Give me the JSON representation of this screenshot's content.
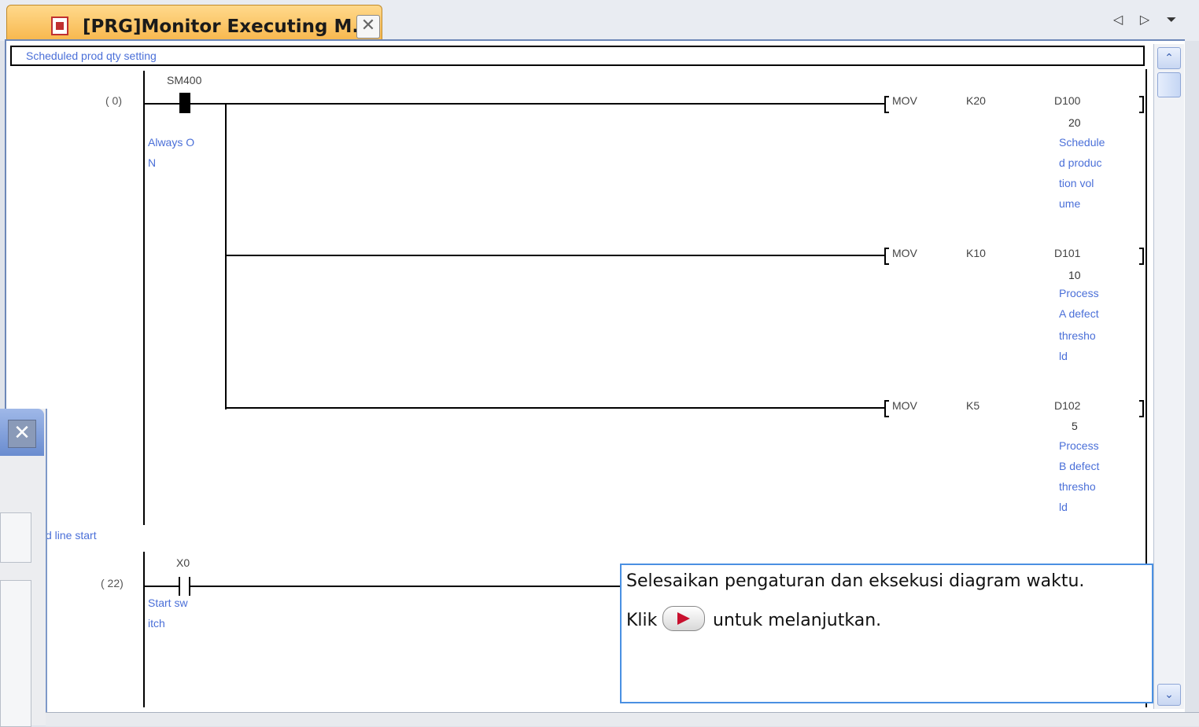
{
  "tab": {
    "title": "[PRG]Monitor Executing M...",
    "close_glyph": "✕",
    "icon": "ladder-program-icon"
  },
  "nav": {
    "prev": "◁",
    "next": "▷",
    "menu": "⏷"
  },
  "statement": "Scheduled prod qty setting",
  "rungs": [
    {
      "step": "(     0)",
      "contact": {
        "device": "SM400",
        "comment_lines": [
          "Always O",
          "N"
        ]
      },
      "instructions": [
        {
          "op": "MOV",
          "src": "K20",
          "dst": "D100",
          "value": "20",
          "comment_lines": [
            "Schedule",
            "d produc",
            "tion vol",
            "ume"
          ]
        },
        {
          "op": "MOV",
          "src": "K10",
          "dst": "D101",
          "value": "10",
          "comment_lines": [
            "Process",
            "A defect",
            "thresho",
            "ld"
          ]
        },
        {
          "op": "MOV",
          "src": "K5",
          "dst": "D102",
          "value": "5",
          "comment_lines": [
            "Process",
            "B defect",
            "thresho",
            "ld"
          ]
        }
      ]
    },
    {
      "step": "(    22)",
      "note": "d line start",
      "contact": {
        "device": "X0",
        "comment_lines": [
          "Start sw",
          "itch"
        ]
      }
    }
  ],
  "callout": {
    "line1": "Selesaikan pengaturan dan eksekusi diagram waktu.",
    "klik": "Klik",
    "after": "untuk melanjutkan.",
    "play_icon": "play-button-icon"
  },
  "left_panel": {
    "close_glyph": "✕"
  },
  "scrollbar": {
    "up": "⌃",
    "down": "⌄"
  }
}
